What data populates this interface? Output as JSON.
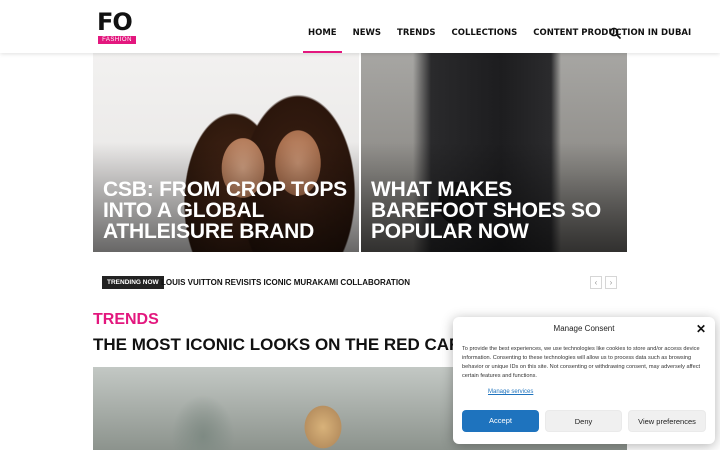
{
  "header": {
    "logo_text": "FO",
    "logo_sub": "FASHION",
    "nav": [
      "HOME",
      "NEWS",
      "TRENDS",
      "COLLECTIONS",
      "CONTENT PRODUCTION IN DUBAI"
    ],
    "active_nav": "HOME",
    "search_icon": "search-icon"
  },
  "hero": {
    "left_title": "CSB: FROM CROP TOPS INTO A GLOBAL ATHLEISURE BRAND",
    "right_title": "WHAT MAKES BAREFOOT SHOES SO POPULAR NOW"
  },
  "trending": {
    "badge": "TRENDING NOW",
    "headline": "LOUIS VUITTON REVISITS ICONIC MURAKAMI COLLABORATION",
    "prev_icon": "chevron-left-icon",
    "next_icon": "chevron-right-icon"
  },
  "article": {
    "category": "TRENDS",
    "title": "THE MOST ICONIC LOOKS ON THE RED CARPET 2024"
  },
  "consent": {
    "title": "Manage Consent",
    "body": "To provide the best experiences, we use technologies like cookies to store and/or access device information. Consenting to these technologies will allow us to process data such as browsing behavior or unique IDs on this site. Not consenting or withdrawing consent, may adversely affect certain features and functions.",
    "manage_link": "Manage services",
    "accept": "Accept",
    "deny": "Deny",
    "view_preferences": "View preferences"
  },
  "colors": {
    "accent": "#e3177e",
    "consent_button": "#1e73be"
  }
}
